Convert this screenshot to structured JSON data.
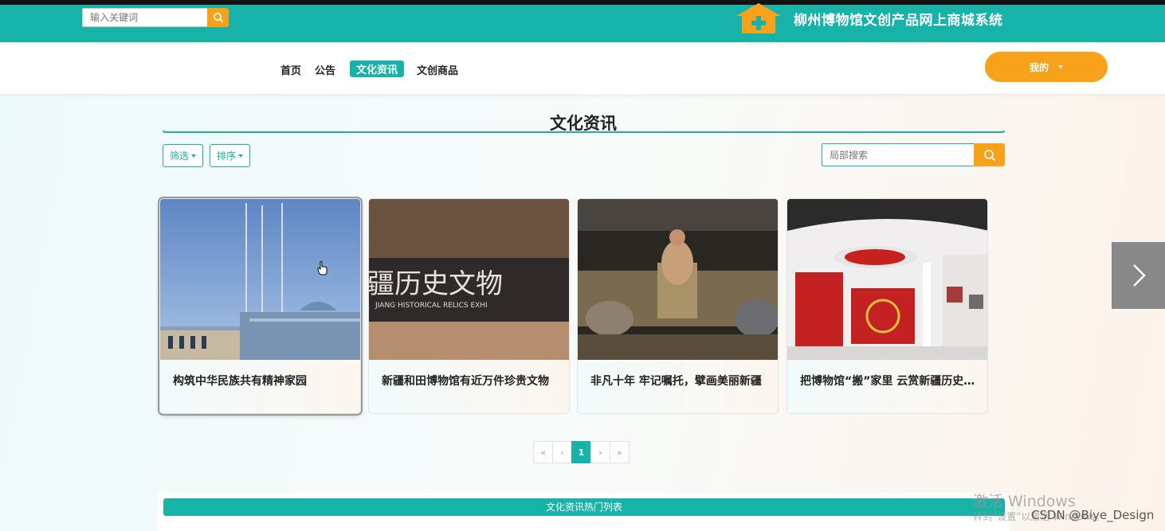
{
  "header": {
    "search_placeholder": "输入关键词",
    "site_title": "柳州博物馆文创产品网上商城系统"
  },
  "nav": {
    "items": [
      {
        "label": "首页"
      },
      {
        "label": "公告"
      },
      {
        "label": "文化资讯",
        "active": true
      },
      {
        "label": "文创商品"
      }
    ],
    "user_label": "我的"
  },
  "section": {
    "title": "文化资讯",
    "filter_label": "筛选",
    "sort_label": "排序",
    "local_search_placeholder": "局部搜索"
  },
  "cards": [
    {
      "title": "构筑中华民族共有精神家园"
    },
    {
      "title": "新疆和田博物馆有近万件珍贵文物",
      "image_text": "疆历史文物",
      "image_subtext": "JIANG HISTORICAL RELICS EXHI"
    },
    {
      "title": "非凡十年 牢记嘱托，擘画美丽新疆"
    },
    {
      "title": "把博物馆“搬”家里 云赏新疆历史文物"
    }
  ],
  "pagination": {
    "first": "«",
    "prev": "‹",
    "current": "1",
    "next": "›",
    "last": "»"
  },
  "hot_list_title": "文化资讯热门列表",
  "watermark": {
    "activate": "激活 Windows",
    "activate_sub": "转到“设置”以激活 Windows。",
    "credit": "CSDN @Biye_Design"
  },
  "colors": {
    "accent": "#18b3a8",
    "orange": "#f7a21a"
  }
}
